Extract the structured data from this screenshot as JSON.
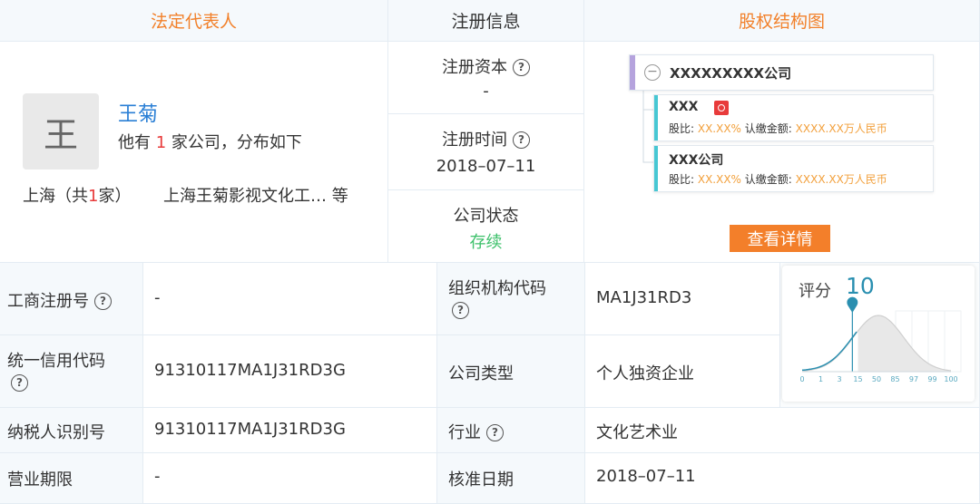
{
  "header": {
    "legal_rep": "法定代表人",
    "reg_info": "注册信息",
    "equity": "股权结构图"
  },
  "legal_rep": {
    "avatar_char": "王",
    "name": "王菊",
    "desc_pre": "他有 ",
    "count": "1",
    "desc_post": " 家公司，分布如下",
    "loc_pre": "上海（共",
    "loc_count": "1",
    "loc_post": "家）",
    "companies": "上海王菊影视文化工…  等"
  },
  "reg_info": {
    "capital_label": "注册资本",
    "capital_value": "-",
    "time_label": "注册时间",
    "time_value": "2018–07–11",
    "status_label": "公司状态",
    "status_value": "存续"
  },
  "equity": {
    "top_company": "XXXXXXXXX公司",
    "holders": [
      {
        "name": "XXX",
        "ratio_label": "股比: ",
        "ratio": "XX.XX%",
        "amount_label": " 认缴金额: ",
        "amount": "XXXX.XX万人民币"
      },
      {
        "name": "XXX公司",
        "ratio_label": "股比: ",
        "ratio": "XX.XX%",
        "amount_label": " 认缴金额: ",
        "amount": "XXXX.XX万人民币"
      }
    ],
    "detail_button": "查看详情"
  },
  "details": {
    "biz_reg_no_label": "工商注册号",
    "biz_reg_no": "-",
    "org_code_label": "组织机构代码",
    "org_code": "MA1J31RD3",
    "credit_code_label": "统一信用代码",
    "credit_code": "91310117MA1J31RD3G",
    "company_type_label": "公司类型",
    "company_type": "个人独资企业",
    "tax_id_label": "纳税人识别号",
    "tax_id": "91310117MA1J31RD3G",
    "industry_label": "行业",
    "industry": "文化艺术业",
    "term_label": "营业期限",
    "term": "-",
    "approve_label": "核准日期",
    "approve": "2018–07–11",
    "help_icon": "?"
  },
  "score": {
    "label": "评分",
    "value": "10",
    "ticks": [
      "0",
      "1",
      "3",
      "15",
      "50",
      "85",
      "97",
      "99",
      "100"
    ],
    "score_value": 10
  },
  "colors": {
    "accent_orange": "#f2812b",
    "link_blue": "#2a7fd5",
    "status_green": "#3cc06a",
    "teal": "#2a8fb0"
  }
}
